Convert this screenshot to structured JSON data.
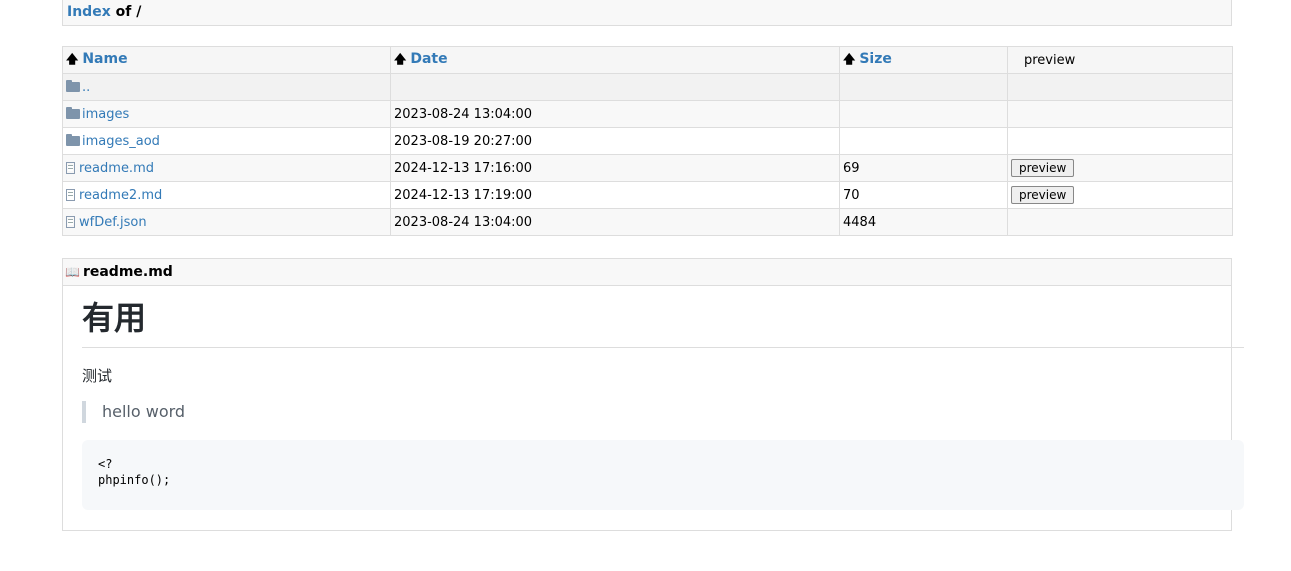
{
  "title": {
    "index": "Index",
    "of": "of",
    "path": "/"
  },
  "table": {
    "headers": {
      "name": "Name",
      "date": "Date",
      "size": "Size",
      "preview": "preview"
    },
    "rows": [
      {
        "name": "..",
        "type": "folder",
        "date": "",
        "size": "",
        "preview": ""
      },
      {
        "name": "images",
        "type": "folder",
        "date": "2023-08-24 13:04:00",
        "size": "",
        "preview": ""
      },
      {
        "name": "images_aod",
        "type": "folder",
        "date": "2023-08-19 20:27:00",
        "size": "",
        "preview": ""
      },
      {
        "name": "readme.md",
        "type": "file",
        "date": "2024-12-13 17:16:00",
        "size": "69",
        "preview": "preview"
      },
      {
        "name": "readme2.md",
        "type": "file",
        "date": "2024-12-13 17:19:00",
        "size": "70",
        "preview": "preview"
      },
      {
        "name": "wfDef.json",
        "type": "file",
        "date": "2023-08-24 13:04:00",
        "size": "4484",
        "preview": ""
      }
    ]
  },
  "readme": {
    "filename": "readme.md",
    "h1": "有用",
    "p": "测试",
    "quote": "hello word",
    "code": "<?\nphpinfo();"
  }
}
